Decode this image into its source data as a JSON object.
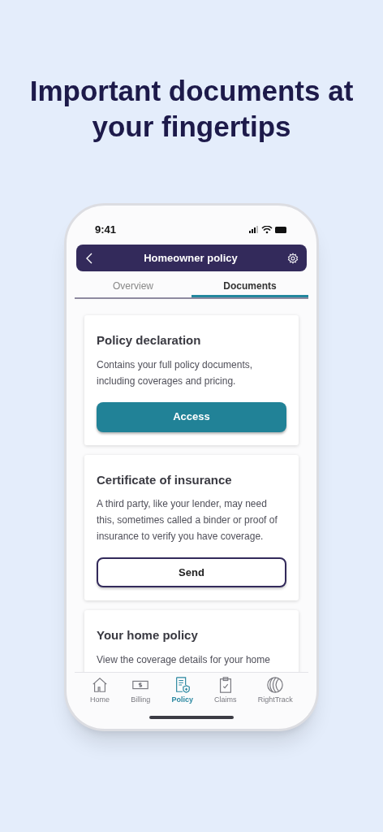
{
  "headline": "Important documents at your fingertips",
  "status_bar": {
    "time": "9:41"
  },
  "header": {
    "title": "Homeowner policy"
  },
  "tabs": [
    {
      "label": "Overview",
      "selected": false
    },
    {
      "label": "Documents",
      "selected": true
    }
  ],
  "cards": [
    {
      "title": "Policy declaration",
      "text": "Contains your full policy documents, including coverages and pricing.",
      "button": {
        "label": "Access",
        "kind": "filled"
      }
    },
    {
      "title": "Certificate of insurance",
      "text": "A third party, like your lender, may need this, sometimes called a binder or proof of insurance to verify you have coverage.",
      "button": {
        "label": "Send",
        "kind": "outline"
      }
    },
    {
      "title": "Your home policy",
      "text": "View the coverage details for your home"
    }
  ],
  "nav": [
    {
      "label": "Home",
      "selected": false
    },
    {
      "label": "Billing",
      "selected": false
    },
    {
      "label": "Policy",
      "selected": true
    },
    {
      "label": "Claims",
      "selected": false
    },
    {
      "label": "RightTrack",
      "selected": false
    }
  ]
}
